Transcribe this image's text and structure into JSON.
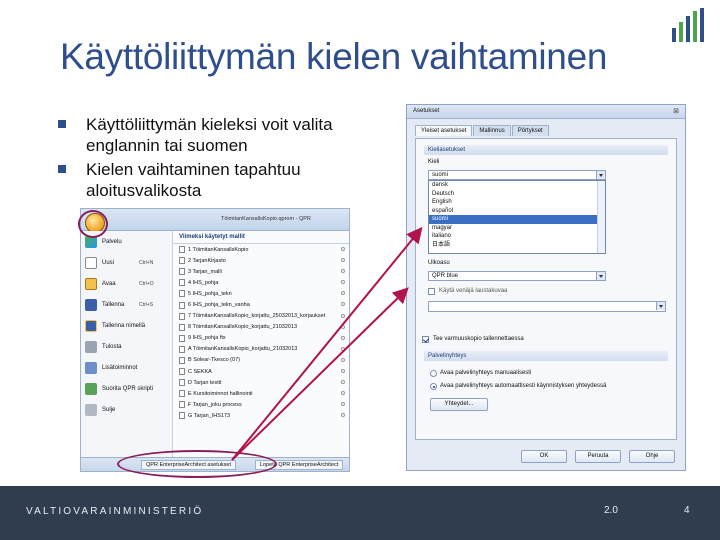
{
  "slide": {
    "title": "Käyttöliittymän kielen vaihtaminen",
    "bullets": [
      "Käyttöliittymän kieleksi voit valita englannin tai suomen",
      "Kielen vaihtaminen tapahtuu aloitusvalikosta"
    ]
  },
  "office_menu": {
    "top_text": "TöimitanKansallsKopio.qprom - QPR",
    "items": [
      {
        "label": "Palvelu",
        "shortcut": "",
        "icon": "palvelu-icon"
      },
      {
        "label": "Uusi",
        "shortcut": "Ctrl+N",
        "icon": "new-icon"
      },
      {
        "label": "Avaa",
        "shortcut": "Ctrl+O",
        "icon": "open-icon"
      },
      {
        "label": "Tallenna",
        "shortcut": "Ctrl+S",
        "icon": "save-icon"
      },
      {
        "label": "Tallenna nimellä",
        "shortcut": "",
        "icon": "save-as-icon"
      },
      {
        "label": "Tulosta",
        "shortcut": "",
        "icon": "print-icon"
      },
      {
        "label": "Lisätoiminnot",
        "shortcut": "",
        "icon": "tools-icon"
      },
      {
        "label": "Suorita QPR skripti",
        "shortcut": "",
        "icon": "script-icon"
      },
      {
        "label": "Sulje",
        "shortcut": "",
        "icon": "close-icon"
      }
    ],
    "recent_header": "Viimeksi käytetyt mallit",
    "recent": [
      "1 TöimitanKansallsKopio",
      "2 TarjanKirjasto",
      "3 Tarjan_malli",
      "4 IHS_pohja",
      "5 IHS_pohja_tekn",
      "6 IHS_pohja_tekn_vanha",
      "7 TöimitanKansallsKopio_korjattu_25032013_korjaukset",
      "8 TöimitanKansallsKopio_korjattu_21032013",
      "9 IHS_pohja ftx",
      "A TöimitanKansallsKopio_korjattu_21032013",
      "B Solear-Tkesco (07)",
      "C SEKKA",
      "D Tarjan testit",
      "E Kursitoiminnot hallinointi",
      "F Tarjan_joku process",
      "G Tarjan_IHS173"
    ],
    "bottom_buttons": [
      "QPR EnterpriseArchitect asetukset",
      "Lopeta QPR EnterpriseArchitect"
    ]
  },
  "dialog": {
    "title": "Asetukset",
    "close": "⊠",
    "tabs": [
      "Yleiset asetukset",
      "Mallinnus",
      "Pörtykset"
    ],
    "lang_group": "Kieliasetukset",
    "lang_label": "Kieli",
    "lang_value": "suomi",
    "languages": [
      "dansk",
      "Deutsch",
      "English",
      "español",
      "suomi",
      "magyar",
      "italiano",
      "日本語"
    ],
    "selected_language_index": 4,
    "layout_label": "Ulkoasu",
    "layout_value": "QPR blue",
    "tooltip_label": "Käytä venäjä laustakuvaa",
    "backup_label": "Tee varmuuskopio tallennettaessa",
    "backup_checked": true,
    "connection_group": "Palvelinyhteys",
    "radio_manual": "Avaa palvelinyhteys manuaalisesti",
    "radio_auto": "Avaa palvelinyhteys automaattisesti käynnistyksen yhteydessä",
    "radio_auto_checked": true,
    "connections_button": "Yhteydet...",
    "ok": "OK",
    "cancel": "Peruuta",
    "help": "Ohje"
  },
  "footer": {
    "brand": "VALTIOVARAINMINISTERIÖ",
    "date": "2.0",
    "page": "4"
  },
  "colors": {
    "title": "#2e4e8c",
    "footer_bg": "#2f3d4f",
    "highlight_circle": "#8a1e5a",
    "arrow": "#b0134e"
  }
}
